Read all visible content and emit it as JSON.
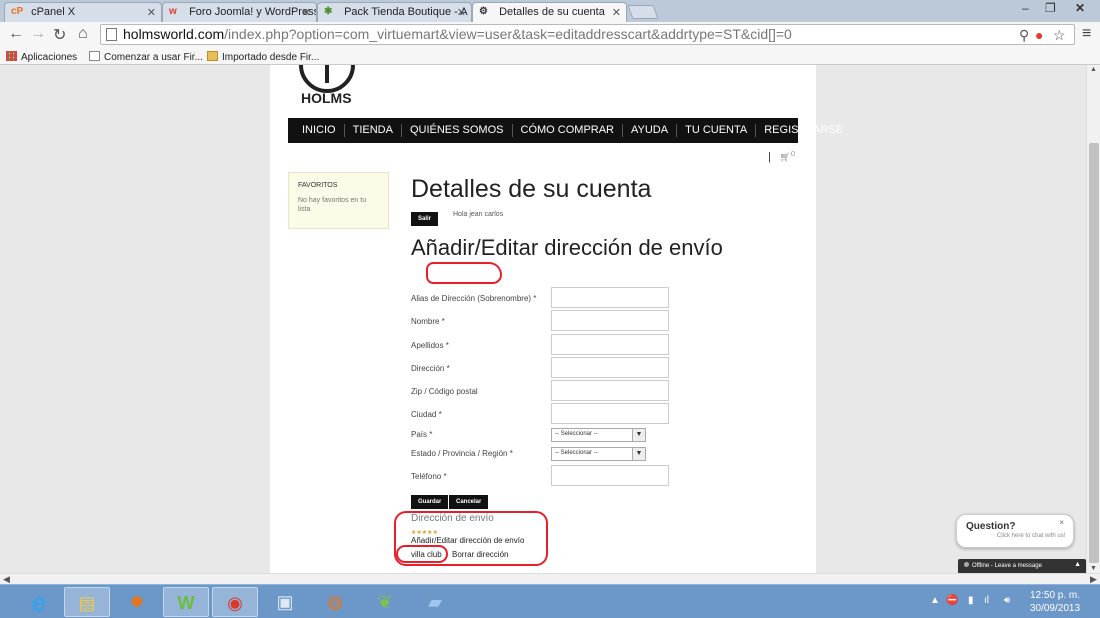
{
  "browser": {
    "tabs": [
      {
        "title": "cPanel X",
        "icon": "cpanel-icon",
        "icon_glyph": "cP",
        "icon_color": "#e8731d",
        "active": false
      },
      {
        "title": "Foro Joomla! y WordPress",
        "icon": "forum-icon",
        "icon_glyph": "w",
        "icon_color": "#e53b2c",
        "active": false
      },
      {
        "title": "Pack Tienda Boutique - A",
        "icon": "joomla-icon",
        "icon_glyph": "✱",
        "icon_color": "#4a8e2e",
        "active": false
      },
      {
        "title": "Detalles de su cuenta",
        "icon": "holms-icon",
        "icon_glyph": "⚙",
        "icon_color": "#333333",
        "active": true
      }
    ],
    "address_host": "holmsworld.com",
    "address_rest": "/index.php?option=com_virtuemart&view=user&task=editaddresscart&addrtype=ST&cid[]=0",
    "bookmarks": [
      {
        "label": "Aplicaciones",
        "icon": "apps-grid-icon"
      },
      {
        "label": "Comenzar a usar Fir...",
        "icon": "page-icon"
      },
      {
        "label": "Importado desde Fir...",
        "icon": "folder-icon"
      }
    ]
  },
  "site": {
    "logo_text": "HOLMS",
    "nav": [
      "INICIO",
      "TIENDA",
      "QUIÉNES SOMOS",
      "CÓMO COMPRAR",
      "AYUDA",
      "TU CUENTA",
      "REGISTRARSE"
    ],
    "cart_count": "0",
    "favorites": {
      "title": "FAVORITOS",
      "empty_text": "No hay favoritos en tu lista"
    },
    "page_title": "Detalles de su cuenta",
    "logout_label": "Salir",
    "greeting": "Hola jean carlos",
    "section_title": "Añadir/Editar dirección de envío",
    "form": {
      "fields": [
        {
          "label": "Alias de Dirección (Sobrenombre) *",
          "type": "text",
          "value": ""
        },
        {
          "label": "Nombre *",
          "type": "text",
          "value": ""
        },
        {
          "label": "Apellidos *",
          "type": "text",
          "value": ""
        },
        {
          "label": "Dirección *",
          "type": "text",
          "value": ""
        },
        {
          "label": "Zip / Código postal",
          "type": "text",
          "value": ""
        },
        {
          "label": "Ciudad *",
          "type": "text",
          "value": ""
        },
        {
          "label": "País *",
          "type": "select",
          "value": "-- Seleccionar --"
        },
        {
          "label": "Estado / Provincia / Región *",
          "type": "select",
          "value": "-- Seleccionar --"
        },
        {
          "label": "Teléfono *",
          "type": "text",
          "value": ""
        }
      ],
      "save_label": "Guardar",
      "cancel_label": "Cancelar"
    },
    "shipping_title": "Dirección de envío",
    "stars": "★★★★★",
    "add_edit_link": "Añadir/Editar dirección de envío",
    "address_name": "villa club",
    "delete_link": "Borrar dirección",
    "annotation_color": "#e81f2a"
  },
  "chat": {
    "title": "Question?",
    "subtitle": "Click here to chat with us!",
    "close": "×",
    "status": "Offline - Leave a message"
  },
  "taskbar": {
    "apps": [
      {
        "name": "internet-explorer-icon",
        "glyph": "e",
        "color": "#3aa0e8"
      },
      {
        "name": "file-explorer-icon",
        "glyph": "▤",
        "color": "#f2c94c"
      },
      {
        "name": "orange-app-icon",
        "glyph": "✹",
        "color": "#e8731d"
      },
      {
        "name": "w-app-icon",
        "glyph": "W",
        "color": "#6bbf3a"
      },
      {
        "name": "chrome-icon",
        "glyph": "◉",
        "color": "#d93a2e"
      },
      {
        "name": "computer-icon",
        "glyph": "▣",
        "color": "#dfe8f2"
      },
      {
        "name": "firefox-icon",
        "glyph": "◍",
        "color": "#e8731d"
      },
      {
        "name": "leaf-app-icon",
        "glyph": "❦",
        "color": "#7ec24a"
      },
      {
        "name": "notepad-icon",
        "glyph": "▰",
        "color": "#9ec6ee"
      }
    ],
    "time": "12:50 p. m.",
    "date": "30/09/2013"
  }
}
